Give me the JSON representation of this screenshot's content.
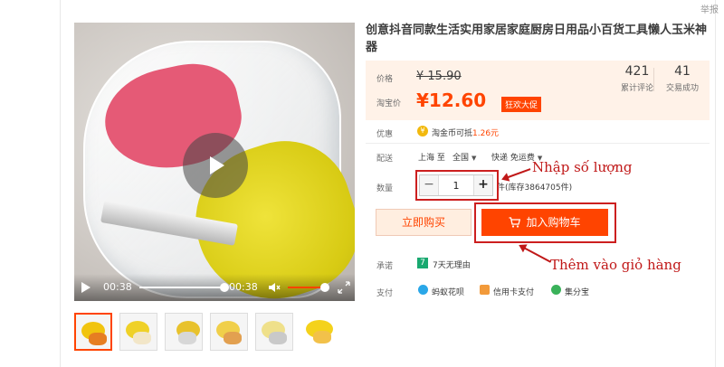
{
  "header": {
    "report_label": "举报"
  },
  "video": {
    "current_time": "00:38",
    "duration": "00:38",
    "progress": 1.0
  },
  "thumbnails": {
    "count": 6,
    "active_index": 0
  },
  "product": {
    "title": "创意抖音同款生活实用家居家庭厨房日用品小百货工具懒人玉米神器",
    "price_label": "价格",
    "original_price": "¥ 15.90",
    "taobao_price_label": "淘宝价",
    "current_price": "¥12.60",
    "promo_tag": "狂欢大促",
    "reviews_count": "421",
    "reviews_label": "累计评论",
    "sales_count": "41",
    "sales_label": "交易成功",
    "discount_label": "优惠",
    "coin_prefix": "淘金币可抵",
    "coin_amount": "1.26元",
    "shipping_label": "配送",
    "ship_from": "上海 至",
    "ship_to": "全国",
    "ship_method": "快递 免运费",
    "quantity_label": "数量",
    "quantity_value": "1",
    "stock_text": "件(库存3864705件)",
    "buy_now_label": "立即购买",
    "add_to_cart_label": "加入购物车",
    "promise_label": "承诺",
    "promise_text": "7天无理由",
    "payment_label": "支付",
    "payment_methods": [
      "蚂蚁花呗",
      "信用卡支付",
      "集分宝"
    ]
  },
  "annotations": {
    "quantity_note": "Nhập số lượng",
    "cart_note": "Thêm vào giỏ hàng"
  },
  "colors": {
    "accent": "#ff4400",
    "annotation": "#c01818",
    "price_bg": "#fff2e8"
  }
}
